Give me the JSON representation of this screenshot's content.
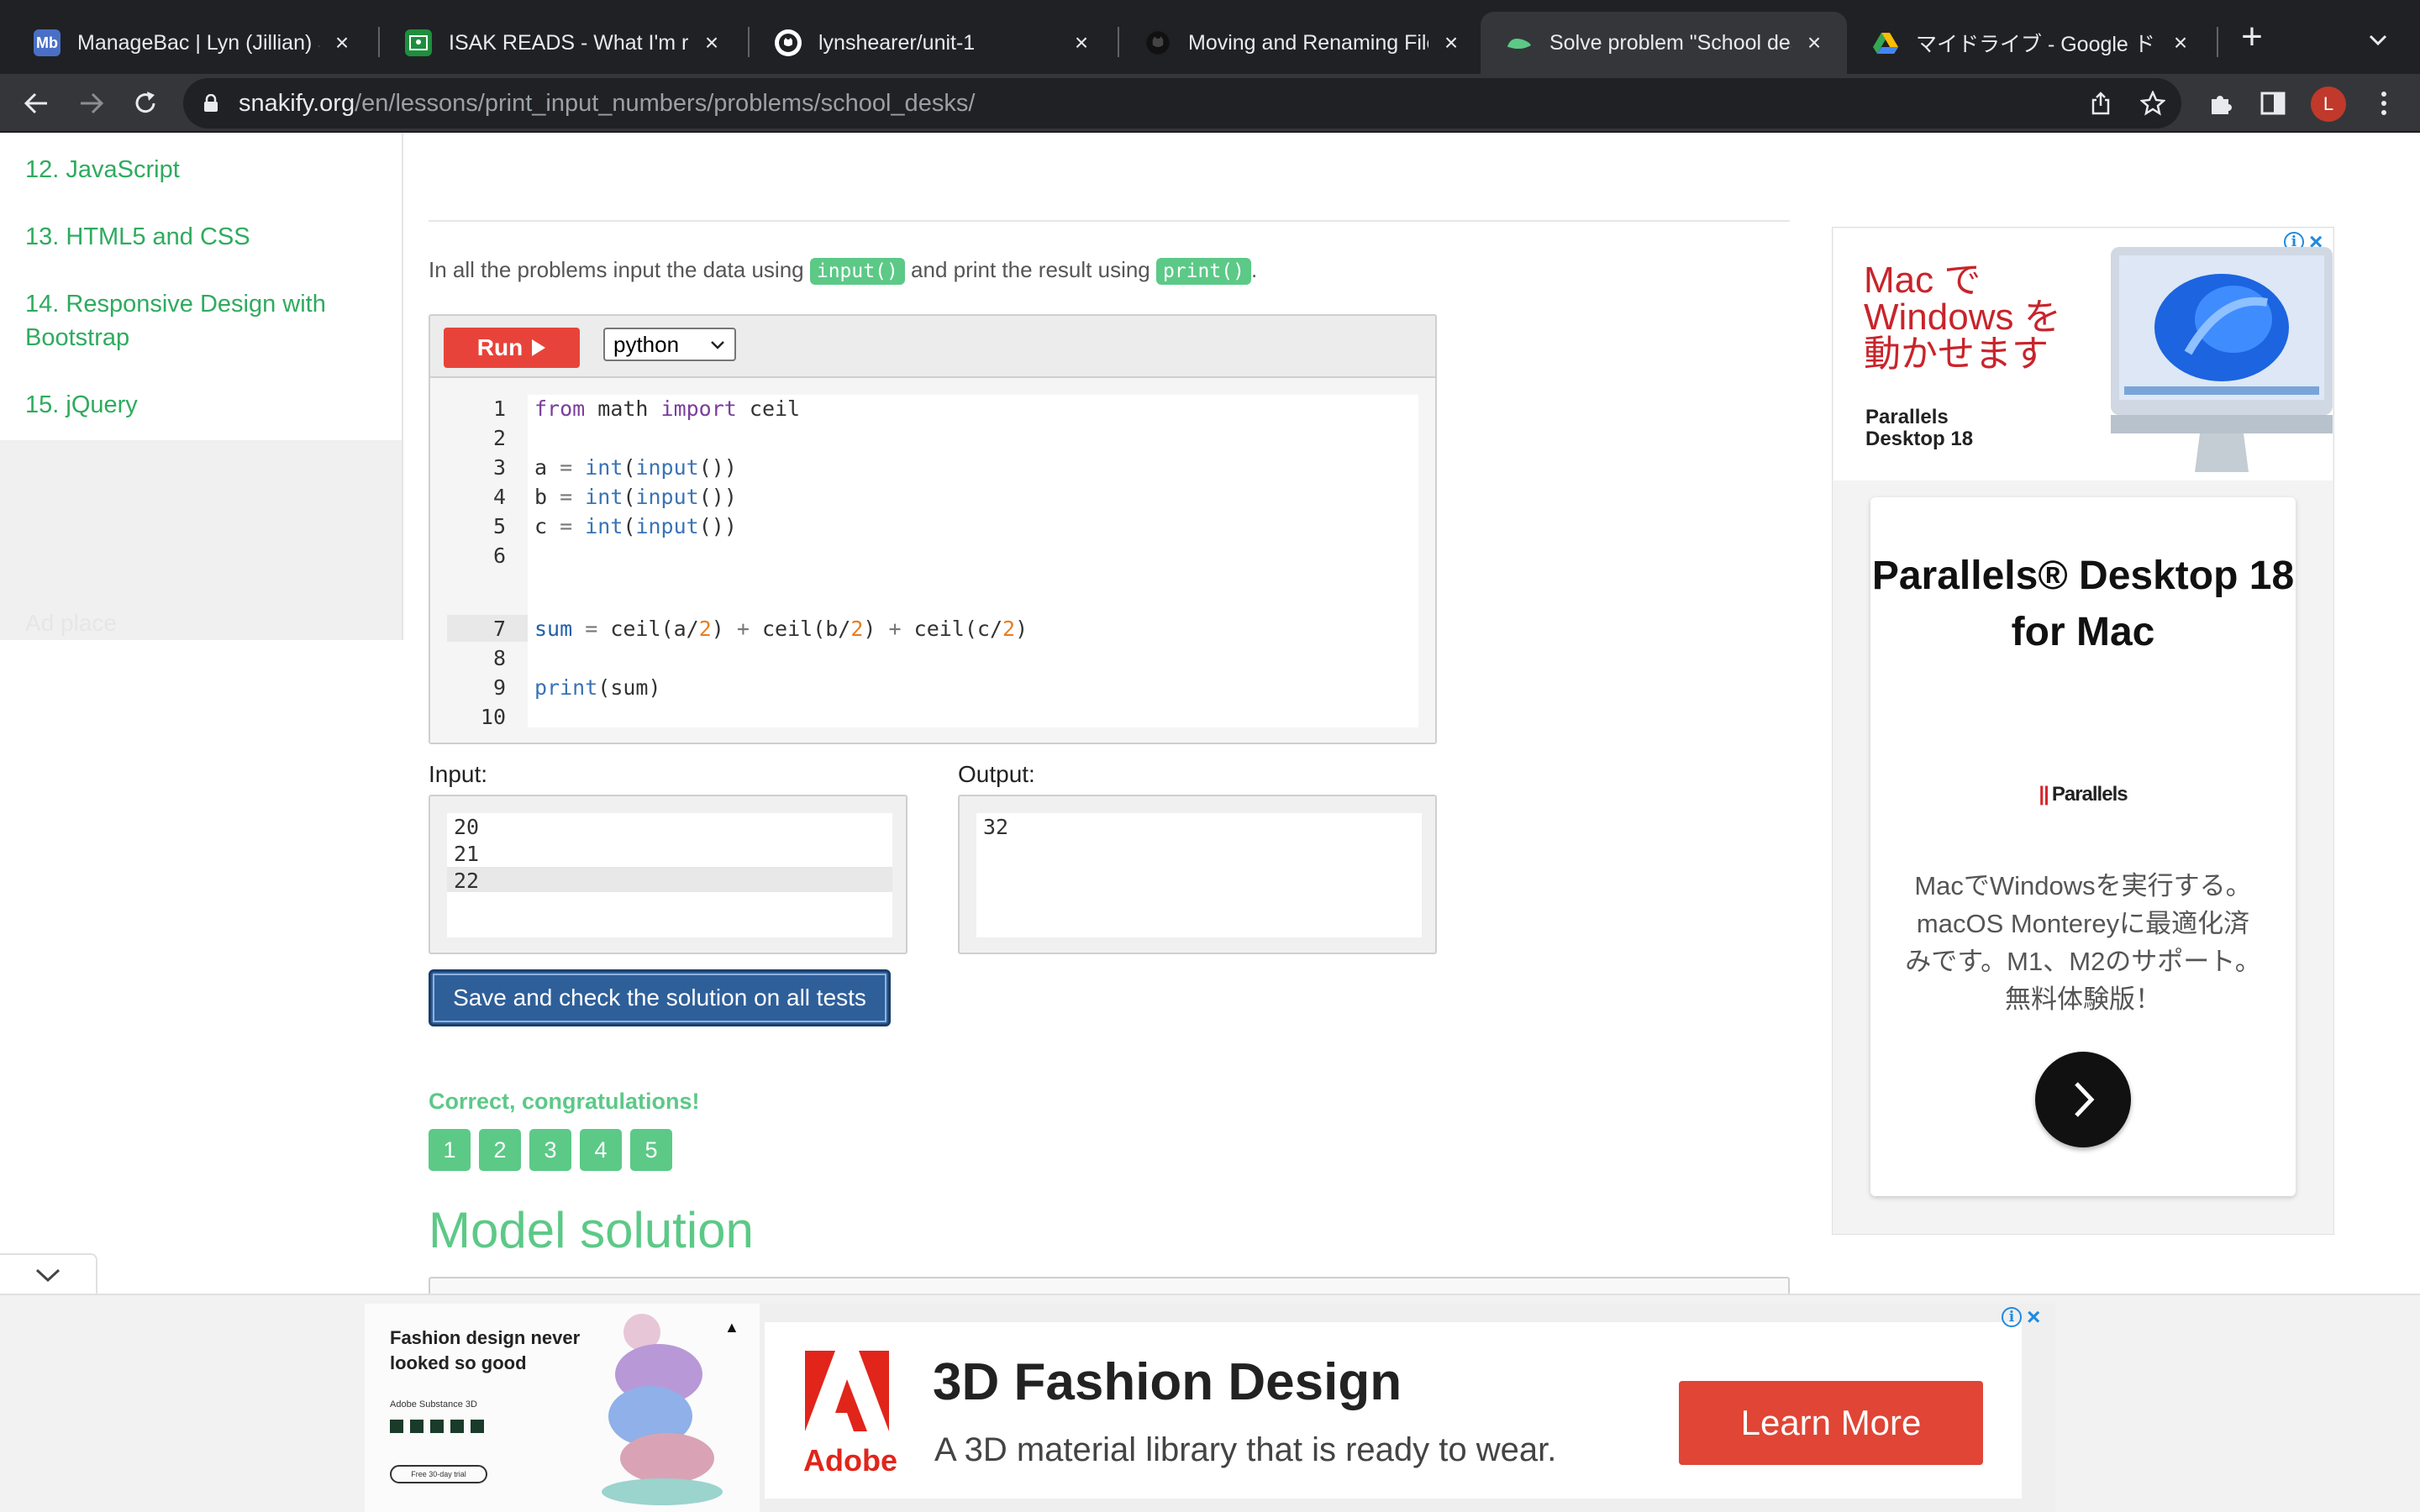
{
  "browser": {
    "tabs": [
      {
        "title": "ManageBac | Lyn (Jillian) Sh",
        "favicon": "managebac-icon",
        "favicon_text": "Mb"
      },
      {
        "title": "ISAK READS - What I'm rea",
        "favicon": "classroom-icon"
      },
      {
        "title": "lynshearer/unit-1",
        "favicon": "github-icon"
      },
      {
        "title": "Moving and Renaming Files",
        "favicon": "github-icon"
      },
      {
        "title": "Solve problem \"School desk",
        "favicon": "snakify-icon",
        "active": true
      },
      {
        "title": "マイドライブ - Google ドライ",
        "favicon": "google-drive-icon"
      }
    ],
    "url_host": "snakify.org",
    "url_path": "/en/lessons/print_input_numbers/problems/school_desks/",
    "profile_initial": "L"
  },
  "sidebar": {
    "items": [
      {
        "label": "12. JavaScript"
      },
      {
        "label": "13. HTML5 and CSS"
      },
      {
        "label": "14. Responsive Design with Bootstrap"
      },
      {
        "label": "15. jQuery"
      }
    ],
    "ad_label": "Ad place"
  },
  "main": {
    "instructions": {
      "part1": "In all the problems input the data using",
      "chip1": "input()",
      "part2": "and print the result using",
      "chip2": "print()",
      "part3": "."
    },
    "run_label": "Run",
    "language": "python",
    "code_lines": [
      "from math import ceil",
      "",
      "a = int(input())",
      "b = int(input())",
      "c = int(input())",
      "",
      "sum = ceil(a/2) + ceil(b/2) + ceil(c/2)",
      "",
      "print(sum)",
      ""
    ],
    "line_numbers": [
      "1",
      "2",
      "3",
      "4",
      "5",
      "6",
      "7",
      "8",
      "9",
      "10"
    ],
    "input_label": "Input:",
    "output_label": "Output:",
    "input_lines": [
      "20",
      "21",
      "22"
    ],
    "output_lines": [
      "32"
    ],
    "save_label": "Save and check the solution on all tests",
    "result_message": "Correct, congratulations!",
    "tests": [
      "1",
      "2",
      "3",
      "4",
      "5"
    ],
    "model_heading": "Model solution"
  },
  "right_ad": {
    "headline": "Mac で Windows を動かせます",
    "brand_small": "Parallels Desktop 18",
    "card_title": "Parallels® Desktop 18 for Mac",
    "logo_text": "Parallels",
    "body": "MacでWindowsを実行する。macOS Montereyに最適化済みです。M1、M2のサポート。無料体験版！",
    "accent_color": "#c8242b"
  },
  "bottom_ad": {
    "small_title": "Fashion design never looked so good",
    "small_sub": "Adobe Substance 3D",
    "small_cta": "Free 30-day trial",
    "brand": "Adobe",
    "title": "3D Fashion Design",
    "subtitle": "A 3D material library that is ready to wear.",
    "cta": "Learn More",
    "accent_color": "#e04535"
  }
}
